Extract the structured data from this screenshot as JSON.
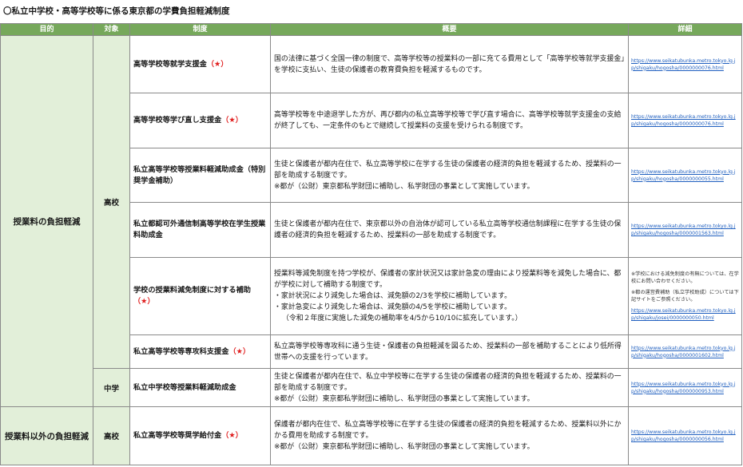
{
  "page": {
    "title": "〇私立中学校・高等学校等に係る東京都の学費負担軽減制度"
  },
  "colors": {
    "header_bg": "#76a85b",
    "merged_bg": "#e2efd9",
    "star": "#e02020",
    "link": "#1f5fbf"
  },
  "table": {
    "headers": [
      "目的",
      "対象",
      "制度",
      "概要",
      "詳細"
    ],
    "purposes": [
      "授業料の負担軽減",
      "授業料以外の負担軽減"
    ],
    "targets": [
      "高校",
      "中学",
      "高校"
    ],
    "rows": [
      {
        "system": "高等学校等就学支援金",
        "star": "（★）",
        "overview": [
          {
            "text": "国の法律に基づく全国一律の制度で、高等学校等の授業料の一部に充てる費用として「高等学校等就学支援金」を学校に支払い、生徒の保護者の教育費負担を軽減するものです。"
          }
        ],
        "notes": [],
        "url": "https://www.seikatubunka.metro.tokyo.lg.jp/shigaku/hogosha/0000000076.html"
      },
      {
        "system": "高等学校等学び直し支援金",
        "star": "（★）",
        "overview": [
          {
            "text": "高等学校等を中途退学した方が、再び都内の私立高等学校等で学び直す場合に、高等学校等就学支援金の支給が終了しても、一定条件のもとで継続して授業料の支援を受けられる制度です。"
          }
        ],
        "notes": [],
        "url": "https://www.seikatubunka.metro.tokyo.lg.jp/shigaku/hogosha/0000000076.html"
      },
      {
        "system": "私立高等学校等授業料軽減助成金（特別奨学金補助）",
        "star": "",
        "overview": [
          {
            "text": "生徒と保護者が都内在住で、私立高等学校に在学する生徒の保護者の経済的負担を軽減するため、授業料の一部を助成する制度です。"
          },
          {
            "text": "※都が（公財）東京都私学財団に補助し、私学財団の事業として実施しています。"
          }
        ],
        "notes": [],
        "url": "https://www.seikatubunka.metro.tokyo.lg.jp/shigaku/hogosha/0000000055.html"
      },
      {
        "system": "私立都認可外通信制高等学校在学生授業料助成金",
        "star": "",
        "overview": [
          {
            "text": "生徒と保護者が都内在住で、東京都以外の自治体が認可している私立高等学校通信制課程に在学する生徒の保護者の経済的負担を軽減するため、授業料の一部を助成する制度です。"
          }
        ],
        "notes": [],
        "url": "https://www.seikatubunka.metro.tokyo.lg.jp/shigaku/hogosha/0000001563.html"
      },
      {
        "system": "学校の授業料減免制度に対する補助",
        "star": "（★）",
        "overview": [
          {
            "text": "授業料等減免制度を持つ学校が、保護者の家計状況又は家計急変の理由により授業料等を減免した場合に、都が学校に対して補助する制度です。"
          },
          {
            "text": "・家計状況により減免した場合は、減免額の2/3を学校に補助しています。"
          },
          {
            "text": "・家計急変により減免した場合は、減免額の4/5を学校に補助しています。"
          },
          {
            "text": "（令和２年度に実施した減免の補助率を4/5から10/10に拡充しています。）",
            "indent": true
          }
        ],
        "notes": [
          "※学校における減免制度の有無については、在学校にお問い合わせください。",
          "※都の運営費補助（私立学校助成）については下記サイトをご参照ください。"
        ],
        "url": "https://www.seikatubunka.metro.tokyo.lg.jp/shigaku/josei/0000000050.html"
      },
      {
        "system": "私立高等学校等専攻科支援金",
        "star": "（★）",
        "overview": [
          {
            "text": "私立高等学校等専攻科に通う生徒・保護者の負担軽減を図るため、授業料の一部を補助することにより低所得世帯への支援を行っています。"
          }
        ],
        "notes": [],
        "url": "https://www.seikatubunka.metro.tokyo.lg.jp/shigaku/hogosha/0000001602.html"
      },
      {
        "system": "私立中学校等授業料軽減助成金",
        "star": "",
        "overview": [
          {
            "text": "生徒と保護者が都内在住で、私立中学校等に在学する生徒の保護者の経済的負担を軽減するため、授業料の一部を助成する制度です。"
          },
          {
            "text": "※都が（公財）東京都私学財団に補助し、私学財団の事業として実施しています。"
          }
        ],
        "notes": [],
        "url": "https://www.seikatubunka.metro.tokyo.lg.jp/shigaku/hogosha/0000000953.html"
      },
      {
        "system": "私立高等学校等奨学給付金",
        "star": "（★）",
        "overview": [
          {
            "text": "保護者が都内在住で、私立高等学校等に在学する生徒の保護者の経済的負担を軽減するため、授業料以外にかかる費用を助成する制度です。"
          },
          {
            "text": "※都が（公財）東京都私学財団に補助し、私学財団の事業として実施しています。"
          }
        ],
        "notes": [],
        "url": "https://www.seikatubunka.metro.tokyo.lg.jp/shigaku/hogosha/0000000056.html"
      }
    ]
  }
}
